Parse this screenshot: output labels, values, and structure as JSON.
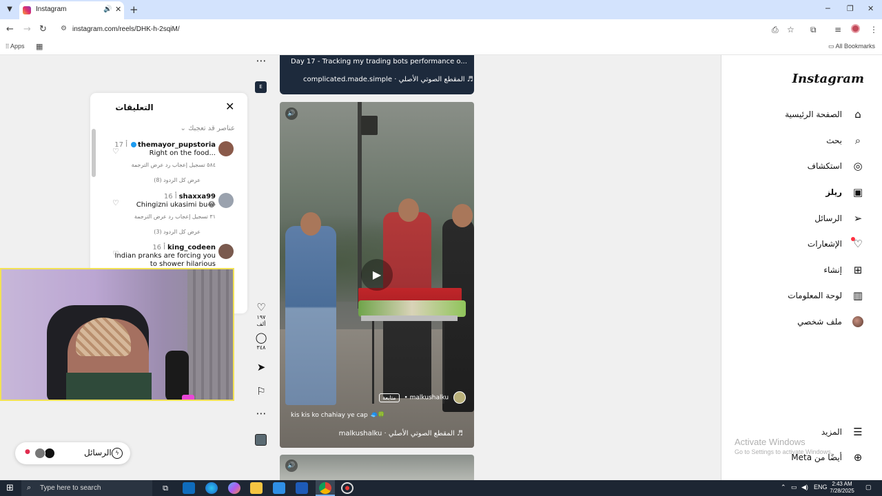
{
  "browser": {
    "tab_title": "Instagram",
    "url": "instagram.com/reels/DHK-h-2sqiM/",
    "bookmarks": {
      "apps_label": "Apps",
      "all_label": "All Bookmarks"
    }
  },
  "sidebar": {
    "logo": "Instagram",
    "items": [
      {
        "label": "الصفحة الرئيسية",
        "icon": "home-icon"
      },
      {
        "label": "بحث",
        "icon": "search-icon"
      },
      {
        "label": "استكشاف",
        "icon": "compass-icon"
      },
      {
        "label": "ريلز",
        "icon": "reels-icon"
      },
      {
        "label": "الرسائل",
        "icon": "send-icon"
      },
      {
        "label": "الإشعارات",
        "icon": "heart-icon"
      },
      {
        "label": "إنشاء",
        "icon": "plus-square-icon"
      },
      {
        "label": "لوحة المعلومات",
        "icon": "dashboard-icon"
      },
      {
        "label": "ملف شخصي",
        "icon": "profile-avatar"
      }
    ],
    "more_label": "المزيد",
    "meta_label": "أيضًا من Meta"
  },
  "watermark": {
    "line1": "Activate Windows",
    "line2": "Go to Settings to activate Windows."
  },
  "comments": {
    "title": "التعليقات",
    "sort_label": "عناصر قد تعجبك",
    "items": [
      {
        "user": "themayor_pupstoria",
        "time": "17 أ",
        "text": "Right on the food...",
        "meta": "٥٨٤ تسجيل إعجاب   رد   عرض الترجمة",
        "replies": "عرض كل الردود (8)",
        "avatar_color": "#8a5a4a"
      },
      {
        "user": "shaxxa99",
        "time": "16 أ",
        "text": "Chingizni ukasimi bu😂",
        "meta": "٣١ تسجيل إعجاب   رد   عرض الترجمة",
        "replies": "عرض كل الردود (3)",
        "avatar_color": "#9aa2ae"
      },
      {
        "user": "king_codeen",
        "time": "16 أ",
        "text": "Indian pranks are forcing you to shower hilarious",
        "meta": "",
        "replies": "",
        "avatar_color": "#7a5a4e"
      }
    ]
  },
  "reel_prev": {
    "title": "Day 17 - Tracking my trading bots performance o... المزيد",
    "audio": "complicated.made.simple · المقطع الصوتي الأصلي ♬"
  },
  "reel": {
    "user": "malkushalku",
    "follow": "متابعة",
    "caption": "kis kis ko chahiay ye cap 🧢🍀",
    "audio": "malkushalku · المقطع الصوتي الأصلي ♬"
  },
  "rail": {
    "likes": "١٩٧ ألف",
    "comments": "٣٤٨",
    "badge": "E"
  },
  "messages_pill": {
    "label": "الرسائل"
  },
  "taskbar": {
    "search_placeholder": "Type here to search",
    "lang": "ENG",
    "time": "2:43 AM",
    "date": "7/28/2025"
  }
}
